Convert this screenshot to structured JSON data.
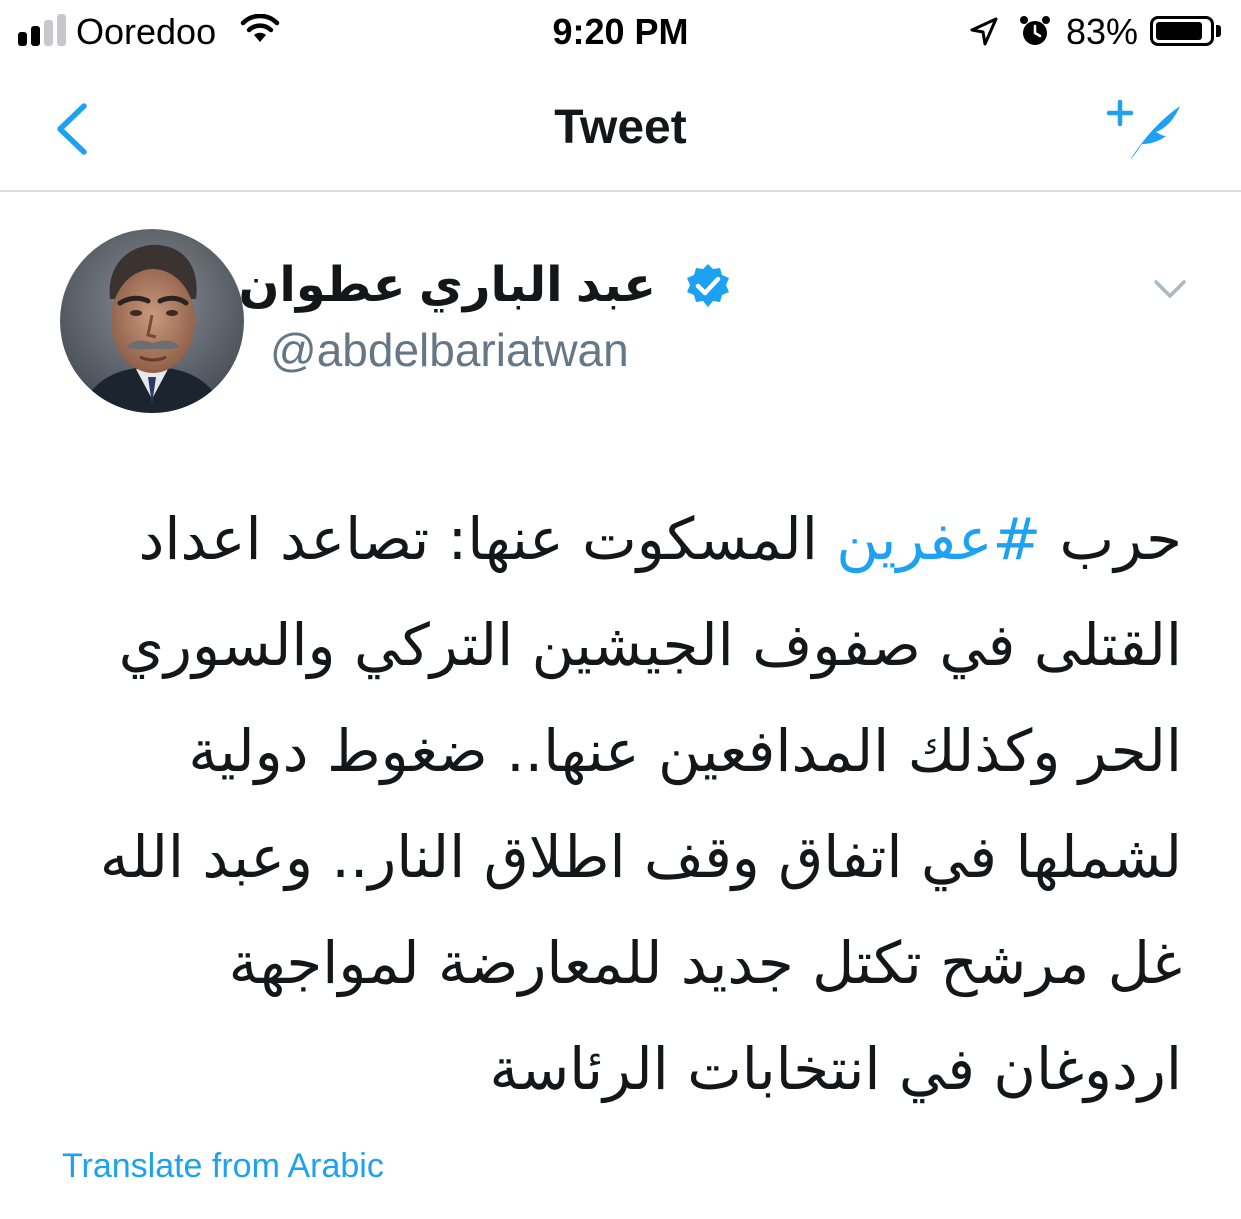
{
  "status_bar": {
    "carrier": "Ooredoo",
    "time": "9:20 PM",
    "battery": "83%",
    "battery_level": 0.83,
    "signal_bars_filled": 2,
    "signal_bars_total": 4
  },
  "nav": {
    "title": "Tweet",
    "back_icon": "chevron-left-icon",
    "compose_icon": "compose-tweet-icon"
  },
  "tweet": {
    "display_name": "عبد الباري عطوان",
    "handle": "@abdelbariatwan",
    "verified": true,
    "text_lines": {
      "l1_pre": "حرب ",
      "l1_hashtag": "#عفرين",
      "l1_post": " المسكوت عنها: تصاعد اعداد",
      "l2": "القتلى في صفوف الجيشين التركي والسوري",
      "l3": "الحر وكذلك المدافعين عنها.. ضغوط دولية",
      "l4": "لشملها في اتفاق وقف اطلاق النار.. وعبد الله",
      "l5": "غل مرشح تكتل جديد للمعارضة لمواجهة",
      "l6": "اردوغان في انتخابات الرئاسة"
    },
    "translate_label": "Translate from Arabic"
  },
  "colors": {
    "accent": "#1da1f2",
    "text": "#14171a",
    "secondary": "#657786",
    "divider": "#d9dde0"
  }
}
